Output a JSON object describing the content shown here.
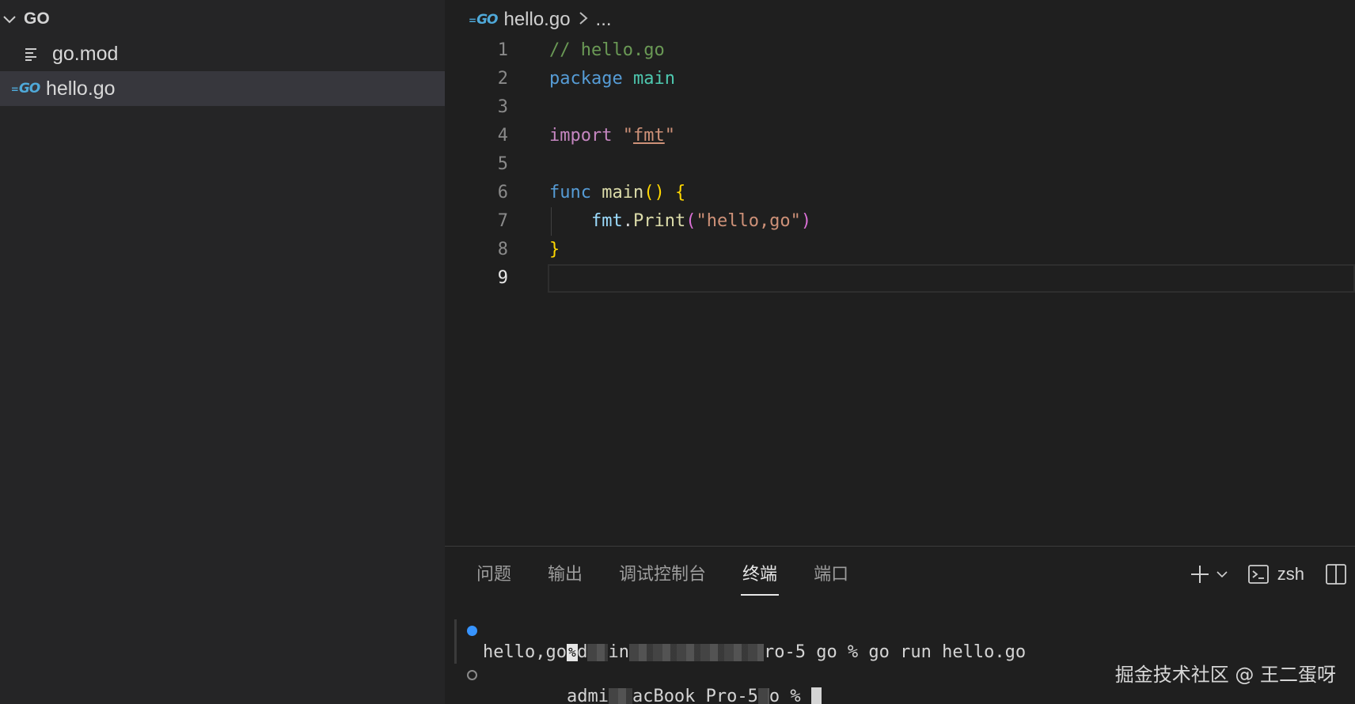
{
  "explorer": {
    "folder": "GO",
    "files": [
      {
        "name": "go.mod",
        "icon": "list-icon",
        "selected": false
      },
      {
        "name": "hello.go",
        "icon": "go-file-icon",
        "selected": true
      }
    ]
  },
  "editor": {
    "breadcrumb": {
      "file": "hello.go",
      "rest": "..."
    },
    "go_logo_text": "GO",
    "line_numbers": [
      "1",
      "2",
      "3",
      "4",
      "5",
      "6",
      "7",
      "8",
      "9"
    ],
    "current_line": "9",
    "code": {
      "l1_comment": "// hello.go",
      "l2_kw": "package",
      "l2_name": "main",
      "l4_kw": "import",
      "l4_q1": "\"",
      "l4_str": "fmt",
      "l4_q2": "\"",
      "l6_kw": "func",
      "l6_fn": "main",
      "l6_parens": "()",
      "l6_brace": "{",
      "l7_pkg": "fmt",
      "l7_dot": ".",
      "l7_fn": "Print",
      "l7_open": "(",
      "l7_str": "\"hello,go\"",
      "l7_close": ")",
      "l8_brace": "}"
    }
  },
  "panel": {
    "tabs": [
      {
        "label": "问题",
        "active": false
      },
      {
        "label": "输出",
        "active": false
      },
      {
        "label": "调试控制台",
        "active": false
      },
      {
        "label": "终端",
        "active": true
      },
      {
        "label": "端口",
        "active": false
      }
    ],
    "shell": "zsh",
    "terminal": {
      "line1_prefix": "ad",
      "line1_mid": "in",
      "line1_suffix": "ro-5 go % go run hello.go",
      "line2_output": "hello,go",
      "line2_eol": "%",
      "line3_prefix": "admi",
      "line3_mid": "acBook Pro-5",
      "line3_suffix": "o % "
    }
  },
  "watermark": "掘金技术社区 @ 王二蛋呀",
  "colors": {
    "sidebar_bg": "#252526",
    "editor_bg": "#1f1f1f",
    "selected_bg": "#37373d",
    "accent_blue": "#3794ff"
  }
}
